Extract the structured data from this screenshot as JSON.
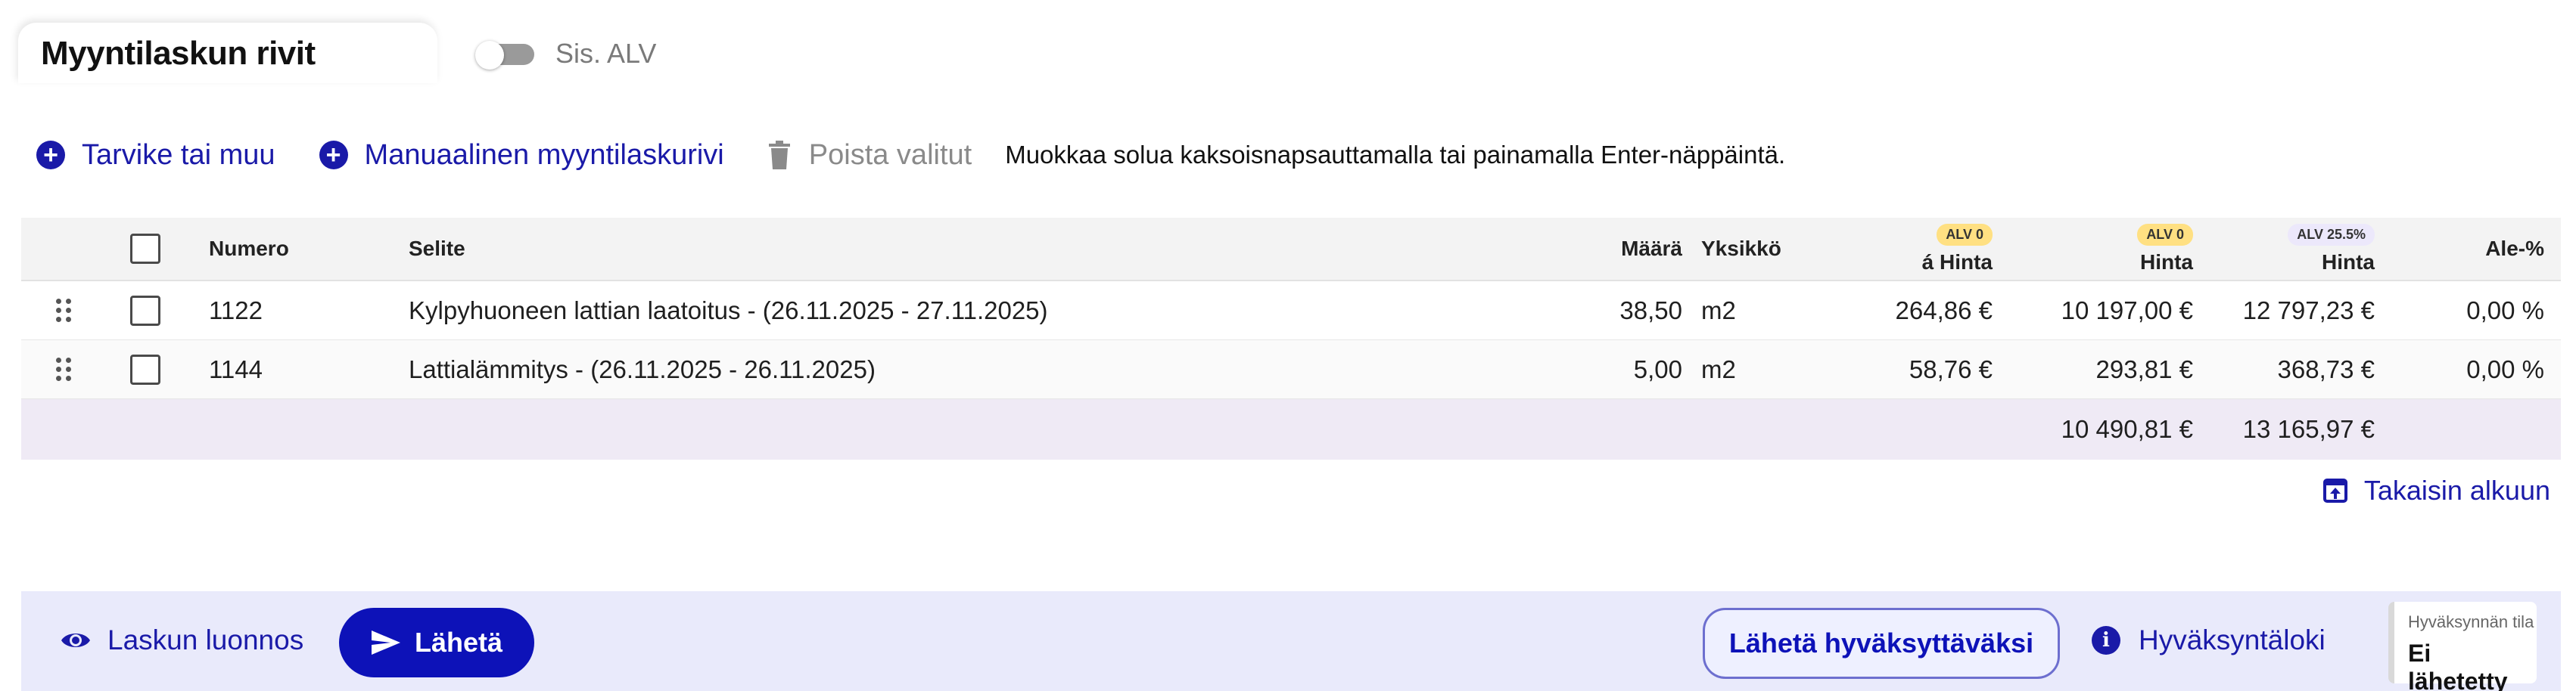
{
  "header": {
    "title": "Myyntilaskun rivit",
    "vat_toggle_label": "Sis. ALV",
    "vat_toggle_on": false
  },
  "toolbar": {
    "add_item_label": "Tarvike tai muu",
    "add_manual_label": "Manuaalinen myyntilaskurivi",
    "delete_selected_label": "Poista valitut",
    "hint": "Muokkaa solua kaksoisnapsauttamalla tai painamalla Enter-näppäintä."
  },
  "table": {
    "columns": {
      "number": "Numero",
      "description": "Selite",
      "quantity": "Määrä",
      "unit": "Yksikkö",
      "unit_price_badge": "ALV 0",
      "unit_price": "á Hinta",
      "price_badge": "ALV 0",
      "price": "Hinta",
      "price_vat_badge": "ALV 25.5%",
      "price_vat": "Hinta",
      "discount": "Ale-%"
    },
    "rows": [
      {
        "number": "1122",
        "description": "Kylpyhuoneen lattian laatoitus - (26.11.2025 - 27.11.2025)",
        "quantity": "38,50",
        "unit": "m2",
        "unit_price": "264,86 €",
        "price": "10 197,00 €",
        "price_vat": "12 797,23 €",
        "discount": "0,00 %"
      },
      {
        "number": "1144",
        "description": "Lattialämmitys - (26.11.2025 - 26.11.2025)",
        "quantity": "5,00",
        "unit": "m2",
        "unit_price": "58,76 €",
        "price": "293,81 €",
        "price_vat": "368,73 €",
        "discount": "0,00 %"
      }
    ],
    "totals": {
      "price": "10 490,81 €",
      "price_vat": "13 165,97 €"
    }
  },
  "back_to_top_label": "Takaisin alkuun",
  "footer": {
    "preview_label": "Laskun luonnos",
    "send_label": "Lähetä",
    "send_for_approval_label": "Lähetä hyväksyttäväksi",
    "approval_log_label": "Hyväksyntäloki",
    "approval_status_label": "Hyväksynnän tila",
    "approval_status_value": "Ei lähetetty"
  },
  "colors": {
    "accent": "#1a1aa8",
    "primary_button": "#0d12b8",
    "footer_bg": "#e9eafb",
    "totals_row_bg": "#efeaf5",
    "badge_vat0": "#ffe082",
    "badge_vat": "#ece8fb"
  }
}
